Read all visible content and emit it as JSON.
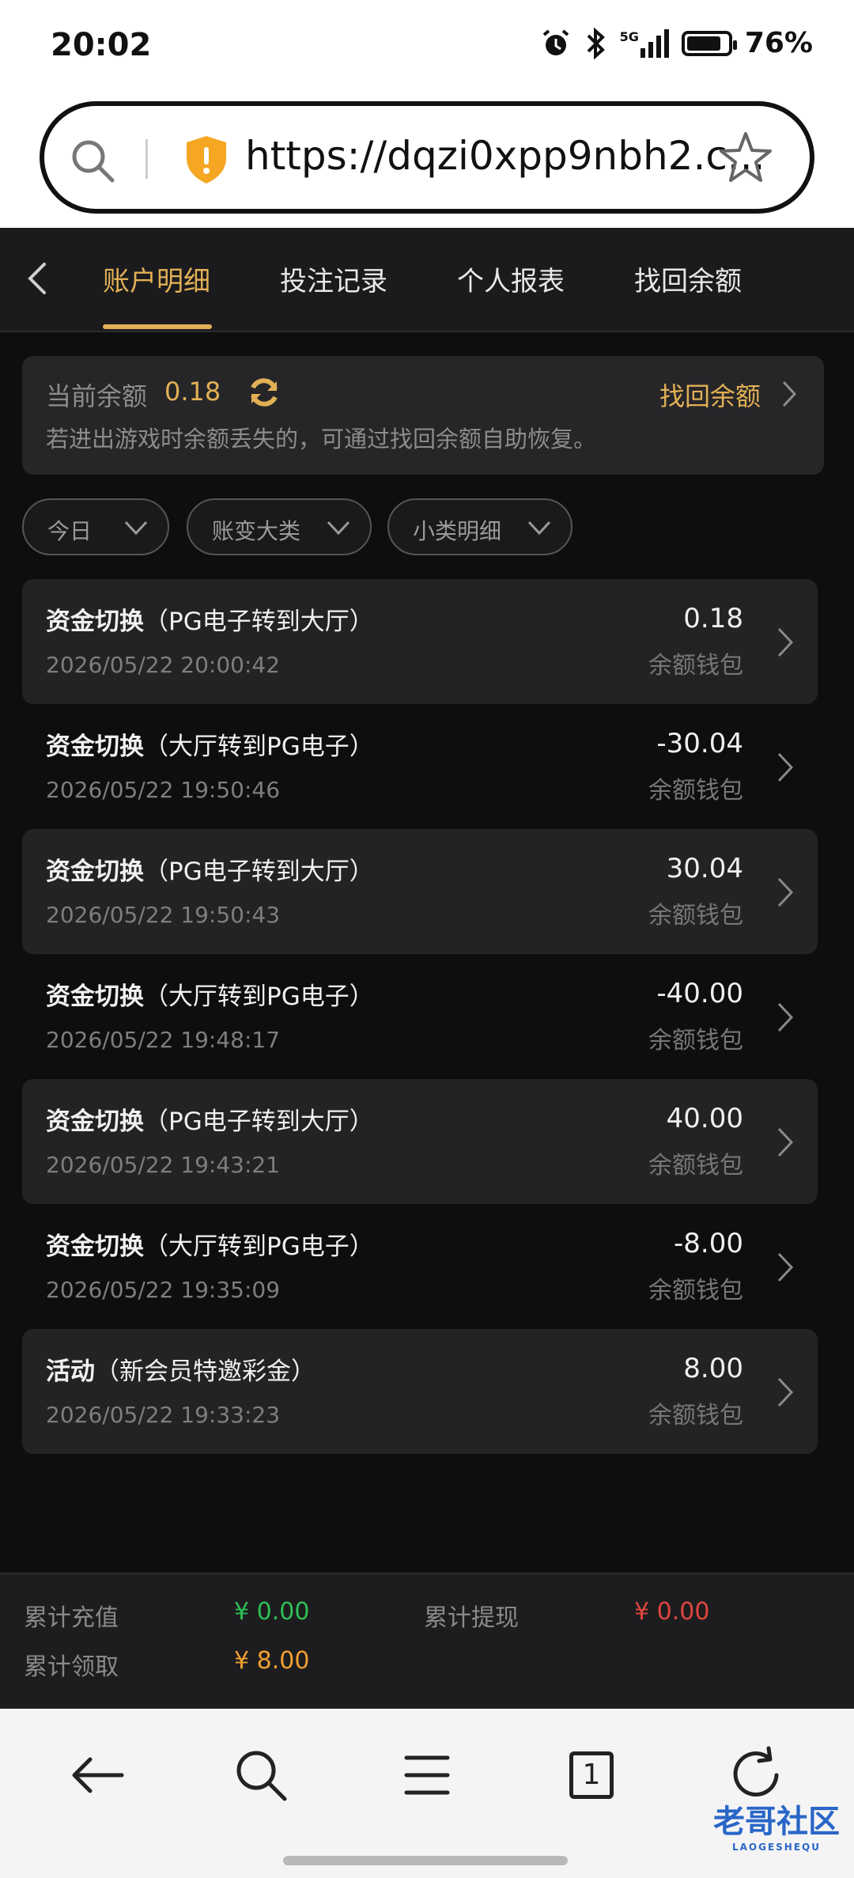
{
  "status": {
    "time": "20:02",
    "network": "5G",
    "battery": "76%"
  },
  "browser": {
    "url": "https://dqzi0xpp9nbh2.c..."
  },
  "header": {
    "tabs": [
      {
        "label": "账户明细",
        "active": true
      },
      {
        "label": "投注记录",
        "active": false
      },
      {
        "label": "个人报表",
        "active": false
      },
      {
        "label": "找回余额",
        "active": false
      }
    ]
  },
  "balance": {
    "label": "当前余额",
    "value": "0.18",
    "recover_label": "找回余额",
    "hint": "若进出游戏时余额丢失的，可通过找回余额自助恢复。"
  },
  "filters": [
    {
      "label": "今日"
    },
    {
      "label": "账变大类"
    },
    {
      "label": "小类明细"
    }
  ],
  "records": [
    {
      "type": "资金切换",
      "detail": "（PG电子转到大厅）",
      "time": "2026/05/22 20:00:42",
      "amount": "0.18",
      "wallet": "余额钱包"
    },
    {
      "type": "资金切换",
      "detail": "（大厅转到PG电子）",
      "time": "2026/05/22 19:50:46",
      "amount": "-30.04",
      "wallet": "余额钱包"
    },
    {
      "type": "资金切换",
      "detail": "（PG电子转到大厅）",
      "time": "2026/05/22 19:50:43",
      "amount": "30.04",
      "wallet": "余额钱包"
    },
    {
      "type": "资金切换",
      "detail": "（大厅转到PG电子）",
      "time": "2026/05/22 19:48:17",
      "amount": "-40.00",
      "wallet": "余额钱包"
    },
    {
      "type": "资金切换",
      "detail": "（PG电子转到大厅）",
      "time": "2026/05/22 19:43:21",
      "amount": "40.00",
      "wallet": "余额钱包"
    },
    {
      "type": "资金切换",
      "detail": "（大厅转到PG电子）",
      "time": "2026/05/22 19:35:09",
      "amount": "-8.00",
      "wallet": "余额钱包"
    },
    {
      "type": "活动",
      "detail": "（新会员特邀彩金）",
      "time": "2026/05/22 19:33:23",
      "amount": "8.00",
      "wallet": "余额钱包"
    }
  ],
  "totals": {
    "recharge_label": "累计充值",
    "recharge_value": "¥ 0.00",
    "withdraw_label": "累计提现",
    "withdraw_value": "¥ 0.00",
    "claimed_label": "累计领取",
    "claimed_value": "¥ 8.00"
  },
  "bottom_nav": {
    "tabs_count": "1"
  },
  "watermark": {
    "text": "老哥社区",
    "sub": "LAOGESHEQU"
  },
  "colors": {
    "accent": "#e2b055",
    "green": "#2fbf55",
    "red": "#e0463f",
    "orange": "#f0a030"
  }
}
